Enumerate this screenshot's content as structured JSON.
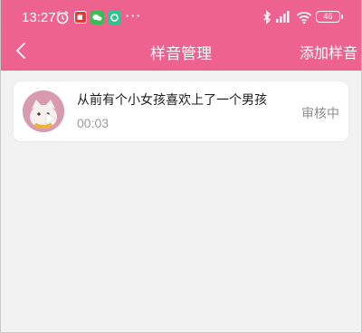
{
  "status_bar": {
    "time": "13:27",
    "battery": "46",
    "icons": [
      "alarm-icon",
      "app-notification-icon",
      "wechat-icon",
      "app-icon",
      "more-dots-icon",
      "bluetooth-icon",
      "signal-icon",
      "wifi-icon",
      "battery-icon"
    ]
  },
  "header": {
    "title": "样音管理",
    "action": "添加样音",
    "back_icon": "chevron-left-icon"
  },
  "samples": [
    {
      "title": "从前有个小女孩喜欢上了一个男孩",
      "duration": "00:03",
      "status": "审核中",
      "avatar_icon": "cat-avatar",
      "play_icon": "play-icon"
    }
  ],
  "colors": {
    "header": "#ee628f",
    "background": "#f2f2f2",
    "card": "#ffffff",
    "muted_text": "#9a9a9a"
  }
}
